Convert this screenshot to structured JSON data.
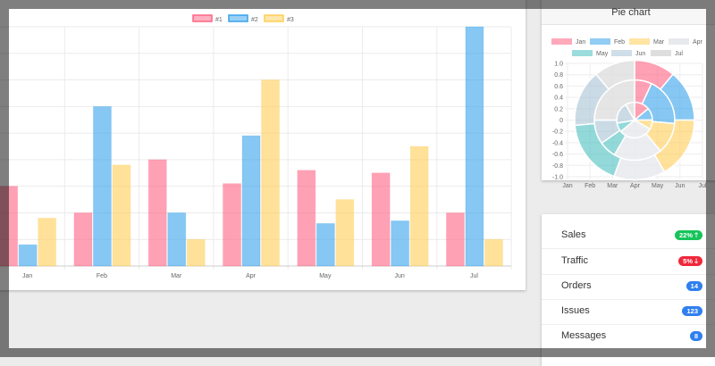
{
  "chart_data": [
    {
      "type": "bar",
      "categories": [
        "Jan",
        "Feb",
        "Mar",
        "Apr",
        "May",
        "Jun",
        "Jul"
      ],
      "series": [
        {
          "name": "#1",
          "color": "#ff6384",
          "values": [
            3,
            2,
            4,
            3.1,
            3.6,
            3.5,
            2
          ]
        },
        {
          "name": "#2",
          "color": "#36a2eb",
          "values": [
            0.8,
            6,
            2,
            4.9,
            1.6,
            1.7,
            9
          ]
        },
        {
          "name": "#3",
          "color": "#ffcd56",
          "values": [
            1.8,
            3.8,
            1,
            7,
            2.5,
            4.5,
            1
          ]
        }
      ],
      "ylim": [
        0,
        9
      ],
      "grid": true,
      "legend": "top"
    },
    {
      "type": "pie",
      "title": "Pie chart",
      "labels": [
        "Jan",
        "Feb",
        "Mar",
        "Apr",
        "May",
        "Jun",
        "Jul"
      ],
      "colors": [
        "#ff6384",
        "#36a2eb",
        "#ffcd56",
        "#e7e9ed",
        "#4bc0c0",
        "#a8c3d6",
        "#dedede"
      ],
      "datasets": [
        [
          40,
          50,
          60,
          50,
          65,
          55,
          40
        ],
        [
          25,
          70,
          45,
          70,
          25,
          35,
          90
        ],
        [
          50,
          40,
          30,
          110,
          30,
          70,
          30
        ]
      ],
      "y_ticks": [
        "1.0",
        "0.8",
        "0.6",
        "0.4",
        "0.2",
        "0",
        "-0.2",
        "-0.4",
        "-0.6",
        "-0.8",
        "-1.0"
      ],
      "x_ticks": [
        "Jan",
        "Feb",
        "Mar",
        "Apr",
        "May",
        "Jun",
        "Jul"
      ],
      "legend": "top"
    }
  ],
  "list": [
    {
      "label": "Sales",
      "badge": "22% 🡑",
      "color": "#16c45a"
    },
    {
      "label": "Traffic",
      "badge": "5% 🡓",
      "color": "#f0283c"
    },
    {
      "label": "Orders",
      "badge": "14",
      "color": "#2f7fef"
    },
    {
      "label": "Issues",
      "badge": "123",
      "color": "#2f7fef"
    },
    {
      "label": "Messages",
      "badge": "8",
      "color": "#2f7fef"
    }
  ]
}
